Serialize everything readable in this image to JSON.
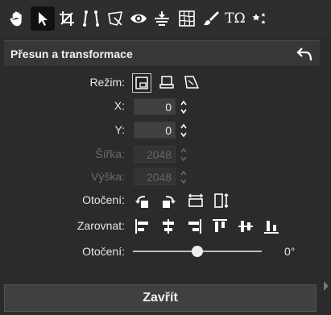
{
  "toolbar": {
    "tools": [
      {
        "name": "hand-tool-icon"
      },
      {
        "name": "select-tool-icon"
      },
      {
        "name": "crop-tool-icon"
      },
      {
        "name": "perspective-tool-icon"
      },
      {
        "name": "transform-tool-icon"
      },
      {
        "name": "redeye-tool-icon"
      },
      {
        "name": "straighten-tool-icon"
      },
      {
        "name": "warp-tool-icon"
      },
      {
        "name": "brush-tool-icon"
      },
      {
        "name": "text-tool-icon"
      },
      {
        "name": "effects-tool-icon"
      }
    ],
    "text_tool_label": "TΩ"
  },
  "panel": {
    "title": "Přesun a transformace",
    "mode_label": "Režim:",
    "x_label": "X:",
    "x_value": "0",
    "y_label": "Y:",
    "y_value": "0",
    "width_label": "Šířka:",
    "width_value": "2048",
    "height_label": "Výška:",
    "height_value": "2048",
    "rotation_buttons_label": "Otočení:",
    "align_label": "Zarovnat:",
    "rotation_slider_label": "Otočení:",
    "rotation_value": "0°",
    "rotation_fraction": 0.5
  },
  "close_button_label": "Zavřít"
}
